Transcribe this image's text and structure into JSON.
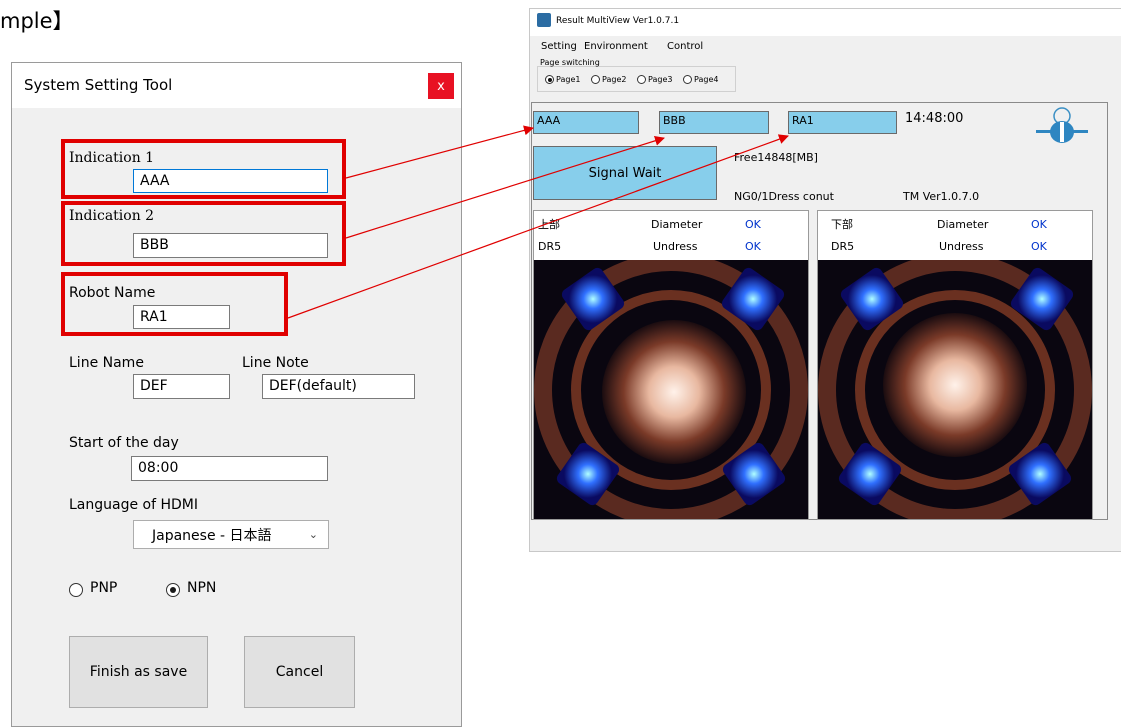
{
  "heading": "mple】",
  "dialog": {
    "title": "System Setting Tool",
    "close": "x",
    "indication1": {
      "label": "Indication 1",
      "value": "AAA"
    },
    "indication2": {
      "label": "Indication 2",
      "value": "BBB"
    },
    "robot_name": {
      "label": "Robot Name",
      "value": "RA1"
    },
    "line_name": {
      "label": "Line Name",
      "value": "DEF"
    },
    "line_note": {
      "label": "Line Note",
      "value": "DEF(default)"
    },
    "start_of_day": {
      "label": "Start of the day",
      "value": "08:00"
    },
    "language": {
      "label": "Language of HDMI",
      "value": "Japanese - 日本語"
    },
    "pnp_label": "PNP",
    "npn_label": "NPN",
    "selected_io": "NPN",
    "finish_button": "Finish as save",
    "cancel_button": "Cancel"
  },
  "viewer": {
    "title": "Result MultiView Ver1.0.7.1",
    "menu": [
      "Setting",
      "Environment",
      "Control"
    ],
    "page_switching_label": "Page switching",
    "pages": [
      "Page1",
      "Page2",
      "Page3",
      "Page4"
    ],
    "selected_page": "Page1",
    "indicator1": "AAA",
    "indicator2": "BBB",
    "indicator3": "RA1",
    "time": "14:48:00",
    "signal_button": "Signal Wait",
    "free_space": "Free14848[MB]",
    "ng_dress_count": "NG0/1Dress conut",
    "tm_version": "TM Ver1.0.7.0",
    "upper": {
      "name": "上部",
      "dr": "DR5",
      "diameter_label": "Diameter",
      "diameter_status": "OK",
      "undress_label": "Undress",
      "undress_status": "OK"
    },
    "lower": {
      "name": "下部",
      "dr": "DR5",
      "diameter_label": "Diameter",
      "diameter_status": "OK",
      "undress_label": "Undress",
      "undress_status": "OK"
    }
  },
  "colors": {
    "highlight_red": "#e00000",
    "indicator_cyan": "#87ceeb",
    "ok_blue": "#0033cc",
    "close_red": "#e81123"
  }
}
